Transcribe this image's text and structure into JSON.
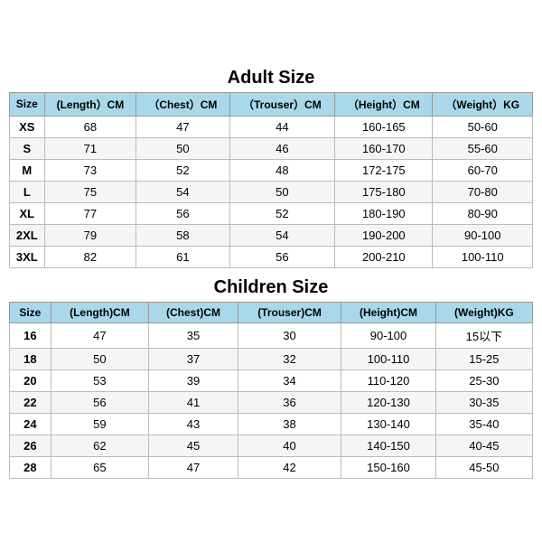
{
  "adult": {
    "title": "Adult Size",
    "headers": [
      "Size",
      "(Length）CM",
      "（Chest）CM",
      "（Trouser）CM",
      "（Height）CM",
      "（Weight）KG"
    ],
    "rows": [
      [
        "XS",
        "68",
        "47",
        "44",
        "160-165",
        "50-60"
      ],
      [
        "S",
        "71",
        "50",
        "46",
        "160-170",
        "55-60"
      ],
      [
        "M",
        "73",
        "52",
        "48",
        "172-175",
        "60-70"
      ],
      [
        "L",
        "75",
        "54",
        "50",
        "175-180",
        "70-80"
      ],
      [
        "XL",
        "77",
        "56",
        "52",
        "180-190",
        "80-90"
      ],
      [
        "2XL",
        "79",
        "58",
        "54",
        "190-200",
        "90-100"
      ],
      [
        "3XL",
        "82",
        "61",
        "56",
        "200-210",
        "100-110"
      ]
    ]
  },
  "children": {
    "title": "Children Size",
    "headers": [
      "Size",
      "(Length)CM",
      "(Chest)CM",
      "(Trouser)CM",
      "(Height)CM",
      "(Weight)KG"
    ],
    "rows": [
      [
        "16",
        "47",
        "35",
        "30",
        "90-100",
        "15以下"
      ],
      [
        "18",
        "50",
        "37",
        "32",
        "100-110",
        "15-25"
      ],
      [
        "20",
        "53",
        "39",
        "34",
        "110-120",
        "25-30"
      ],
      [
        "22",
        "56",
        "41",
        "36",
        "120-130",
        "30-35"
      ],
      [
        "24",
        "59",
        "43",
        "38",
        "130-140",
        "35-40"
      ],
      [
        "26",
        "62",
        "45",
        "40",
        "140-150",
        "40-45"
      ],
      [
        "28",
        "65",
        "47",
        "42",
        "150-160",
        "45-50"
      ]
    ]
  }
}
